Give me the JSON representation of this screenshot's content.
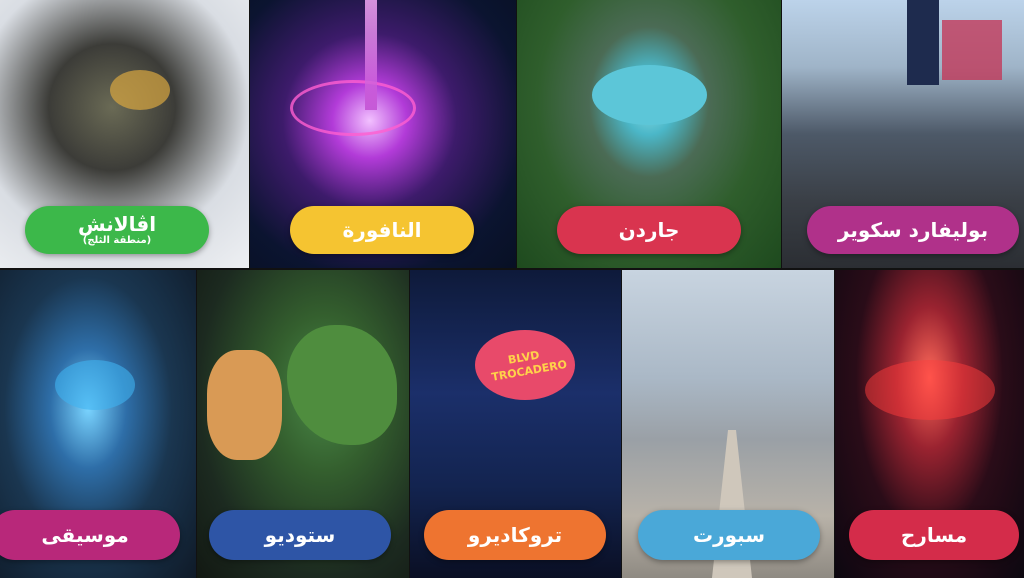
{
  "tiles": {
    "top": [
      {
        "label": "اڤالانش",
        "sublabel": "(منطقة الثلج)",
        "color": "#3cb84a"
      },
      {
        "label": "النافورة",
        "color": "#f5c431"
      },
      {
        "label": "جاردن",
        "color": "#d9344f"
      },
      {
        "label": "بوليفارد سكوير",
        "color": "#b0318a"
      }
    ],
    "bottom": [
      {
        "label": "موسيقى",
        "color": "#b8287a"
      },
      {
        "label": "ستوديو",
        "color": "#2e55a6"
      },
      {
        "label": "تروكاديرو",
        "color": "#ee7430"
      },
      {
        "label": "سبورت",
        "color": "#4aa8d8"
      },
      {
        "label": "مسارح",
        "color": "#d42c4a"
      }
    ]
  },
  "scene_signage": {
    "trocadero_sign": "BLVD TROCADERO"
  }
}
